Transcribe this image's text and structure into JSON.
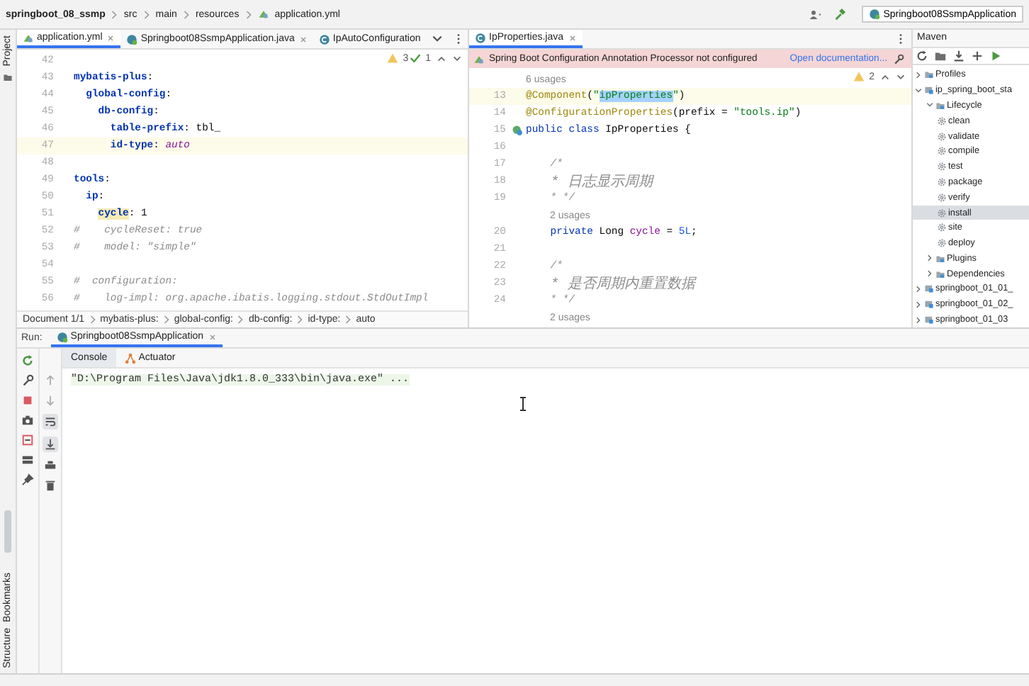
{
  "breadcrumbs": [
    {
      "label": "springboot_08_ssmp",
      "kind": "project"
    },
    {
      "label": "src",
      "kind": "folder"
    },
    {
      "label": "main",
      "kind": "folder"
    },
    {
      "label": "resources",
      "kind": "folder"
    },
    {
      "label": "application.yml",
      "kind": "yml"
    }
  ],
  "run_config": "Springboot08SsmpApplication",
  "side_tabs_top": [
    "Project"
  ],
  "side_tabs_bottom": [
    "Bookmarks",
    "Structure"
  ],
  "left_editor": {
    "tabs": [
      {
        "label": "application.yml",
        "kind": "yml",
        "selected": true,
        "closable": true
      },
      {
        "label": "Springboot08SsmpApplication.java",
        "kind": "spring",
        "selected": false,
        "closable": true
      },
      {
        "label": "IpAutoConfiguration",
        "kind": "class",
        "selected": false,
        "closable": false
      }
    ],
    "warnings": "3",
    "checks": "1",
    "lines": [
      {
        "number": "42",
        "current": false
      },
      {
        "number": "43",
        "current": false,
        "tokens": [
          {
            "kind": "key",
            "text": "mybatis-plus"
          },
          {
            "kind": "plain",
            "text": ":"
          }
        ]
      },
      {
        "number": "44",
        "current": false,
        "tokens": [
          {
            "kind": "key",
            "text": "  global-config"
          },
          {
            "kind": "plain",
            "text": ":"
          }
        ]
      },
      {
        "number": "45",
        "current": false,
        "tokens": [
          {
            "kind": "key",
            "text": "    db-config"
          },
          {
            "kind": "plain",
            "text": ":"
          }
        ]
      },
      {
        "number": "46",
        "current": false,
        "tokens": [
          {
            "kind": "key",
            "text": "      table-prefix"
          },
          {
            "kind": "plain",
            "text": ": tbl_"
          }
        ]
      },
      {
        "number": "47",
        "current": true,
        "tokens": [
          {
            "kind": "key",
            "text": "      id-type"
          },
          {
            "kind": "plain",
            "text": ": "
          },
          {
            "kind": "value",
            "text": "auto"
          }
        ]
      },
      {
        "number": "48",
        "current": false
      },
      {
        "number": "49",
        "current": false,
        "tokens": [
          {
            "kind": "key",
            "text": "tools"
          },
          {
            "kind": "plain",
            "text": ":"
          }
        ]
      },
      {
        "number": "50",
        "current": false,
        "tokens": [
          {
            "kind": "key",
            "text": "  ip"
          },
          {
            "kind": "plain",
            "text": ":"
          }
        ]
      },
      {
        "number": "51",
        "current": false,
        "tokens": [
          {
            "kind": "key",
            "text": "    cycle",
            "marked": true
          },
          {
            "kind": "plain",
            "text": ": 1"
          }
        ]
      },
      {
        "number": "52",
        "current": false,
        "tokens": [
          {
            "kind": "comment",
            "text": "#    cycleReset: true"
          }
        ]
      },
      {
        "number": "53",
        "current": false,
        "tokens": [
          {
            "kind": "comment",
            "text": "#    model: \"simple\""
          }
        ]
      },
      {
        "number": "54",
        "current": false
      },
      {
        "number": "55",
        "current": false,
        "tokens": [
          {
            "kind": "comment",
            "text": "#  configuration:"
          }
        ]
      },
      {
        "number": "56",
        "current": false,
        "tokens": [
          {
            "kind": "comment",
            "text": "#    log-impl: org.apache.ibatis.logging.stdout.StdOutImpl"
          }
        ]
      }
    ],
    "breadcrumb": [
      "Document 1/1",
      "mybatis-plus:",
      "global-config:",
      "db-config:",
      "id-type:",
      "auto"
    ]
  },
  "right_editor": {
    "tabs": [
      {
        "label": "IpProperties.java",
        "kind": "class",
        "selected": true,
        "closable": true
      }
    ],
    "banner": {
      "text": "Spring Boot Configuration Annotation Processor not configured",
      "link": "Open documentation..."
    },
    "warnings": "2",
    "lines": [
      {
        "kind": "inlay",
        "text": "6 usages"
      },
      {
        "kind": "code",
        "number": "13",
        "current": true,
        "bean": false,
        "tokens": [
          {
            "kind": "annotation",
            "text": "@Component"
          },
          {
            "kind": "plain",
            "text": "("
          },
          {
            "kind": "string",
            "text": "\""
          },
          {
            "kind": "string",
            "text": "ipProperties",
            "selected": true
          },
          {
            "kind": "string",
            "text": "\""
          },
          {
            "kind": "plain",
            "text": ")"
          }
        ]
      },
      {
        "kind": "code",
        "number": "14",
        "current": false,
        "bean": false,
        "tokens": [
          {
            "kind": "annotation",
            "text": "@ConfigurationProperties"
          },
          {
            "kind": "plain",
            "text": "(prefix = "
          },
          {
            "kind": "string",
            "text": "\"tools.ip\""
          },
          {
            "kind": "plain",
            "text": ")"
          }
        ]
      },
      {
        "kind": "code",
        "number": "15",
        "current": false,
        "bean": true,
        "tokens": [
          {
            "kind": "keyword",
            "text": "public class "
          },
          {
            "kind": "plain",
            "text": "IpProperties {"
          }
        ]
      },
      {
        "kind": "code",
        "number": "16",
        "current": false,
        "bean": false
      },
      {
        "kind": "code",
        "number": "17",
        "current": false,
        "bean": false,
        "tokens": [
          {
            "kind": "comment",
            "text": "    /*"
          }
        ]
      },
      {
        "kind": "code",
        "number": "18",
        "current": false,
        "bean": false,
        "tokens": [
          {
            "kind": "comment",
            "text": "    * 日志显示周期"
          }
        ]
      },
      {
        "kind": "code",
        "number": "19",
        "current": false,
        "bean": false,
        "tokens": [
          {
            "kind": "comment",
            "text": "    * */"
          }
        ]
      },
      {
        "kind": "inlay",
        "text": "2 usages"
      },
      {
        "kind": "code",
        "number": "20",
        "current": false,
        "bean": false,
        "tokens": [
          {
            "kind": "keyword",
            "text": "    private "
          },
          {
            "kind": "plain",
            "text": "Long "
          },
          {
            "kind": "field",
            "text": "cycle"
          },
          {
            "kind": "plain",
            "text": " = "
          },
          {
            "kind": "number",
            "text": "5L"
          },
          {
            "kind": "plain",
            "text": ";"
          }
        ]
      },
      {
        "kind": "code",
        "number": "21",
        "current": false,
        "bean": false
      },
      {
        "kind": "code",
        "number": "22",
        "current": false,
        "bean": false,
        "tokens": [
          {
            "kind": "comment",
            "text": "    /*"
          }
        ]
      },
      {
        "kind": "code",
        "number": "23",
        "current": false,
        "bean": false,
        "tokens": [
          {
            "kind": "comment",
            "text": "    * 是否周期内重置数据"
          }
        ]
      },
      {
        "kind": "code",
        "number": "24",
        "current": false,
        "bean": false,
        "tokens": [
          {
            "kind": "comment",
            "text": "    * */"
          }
        ]
      },
      {
        "kind": "inlay",
        "text": "2 usages"
      }
    ]
  },
  "maven": {
    "title": "Maven",
    "tree": [
      {
        "label": "Profiles",
        "kind": "profiles",
        "expanded": false,
        "selected": false
      },
      {
        "label": "ip_spring_boot_sta",
        "kind": "module",
        "expanded": true,
        "selected": false,
        "children": [
          {
            "label": "Lifecycle",
            "kind": "folder",
            "expanded": true,
            "selected": false,
            "children": [
              {
                "label": "clean",
                "kind": "goal",
                "selected": false
              },
              {
                "label": "validate",
                "kind": "goal",
                "selected": false
              },
              {
                "label": "compile",
                "kind": "goal",
                "selected": false
              },
              {
                "label": "test",
                "kind": "goal",
                "selected": false
              },
              {
                "label": "package",
                "kind": "goal",
                "selected": false
              },
              {
                "label": "verify",
                "kind": "goal",
                "selected": false
              },
              {
                "label": "install",
                "kind": "goal",
                "selected": true
              },
              {
                "label": "site",
                "kind": "goal",
                "selected": false
              },
              {
                "label": "deploy",
                "kind": "goal",
                "selected": false
              }
            ]
          },
          {
            "label": "Plugins",
            "kind": "folder",
            "expanded": false,
            "selected": false
          },
          {
            "label": "Dependencies",
            "kind": "folder",
            "expanded": false,
            "selected": false
          }
        ]
      },
      {
        "label": "springboot_01_01_",
        "kind": "module",
        "expanded": false,
        "selected": false
      },
      {
        "label": "springboot_01_02_",
        "kind": "module",
        "expanded": false,
        "selected": false
      },
      {
        "label": "springboot_01_03",
        "kind": "module",
        "expanded": false,
        "selected": false
      }
    ]
  },
  "run": {
    "label": "Run:",
    "tab": "Springboot08SsmpApplication",
    "console_tabs": [
      {
        "label": "Console",
        "selected": true
      },
      {
        "label": "Actuator",
        "selected": false
      }
    ],
    "output": "\"D:\\Program Files\\Java\\jdk1.8.0_333\\bin\\java.exe\" ..."
  }
}
